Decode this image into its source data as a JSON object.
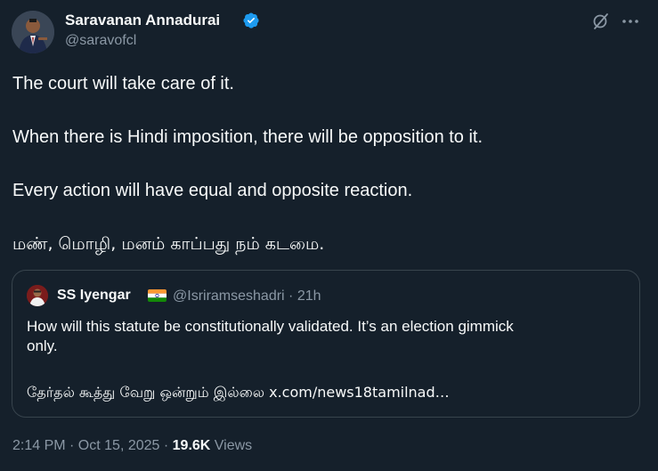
{
  "author": {
    "name": "Saravanan Annadurai",
    "handle": "@saravofcl"
  },
  "tweet": {
    "lines": [
      "The court will take care of it.",
      "When there is Hindi imposition, there will be opposition to it.",
      "Every action will have equal and opposite reaction.",
      "மண், மொழி, மனம் காப்பது நம் கடமை."
    ]
  },
  "quote": {
    "name": "SS Iyengar",
    "handle_time": "@Isriramseshadri · 21h",
    "lines": [
      "How will this statute be constitutionally validated. It’s an election gimmick",
      "only.",
      "தேர்தல் கூத்து வேறு ஒன்றும் இல்லை x.com/news18tamilnad…"
    ]
  },
  "meta": {
    "timestamp": "2:14 PM · Oct 15, 2025 · ",
    "views_count": "19.6K",
    "views_label": " Views"
  },
  "icons": {
    "verified": "verified-badge-icon",
    "grok": "grok-icon",
    "more": "more-options-icon",
    "flag": "india-flag-icon"
  },
  "colors": {
    "background": "#15202b",
    "text": "#f7f9f9",
    "secondary": "#8b98a5",
    "border": "#38444d",
    "verified": "#1d9bf0"
  }
}
